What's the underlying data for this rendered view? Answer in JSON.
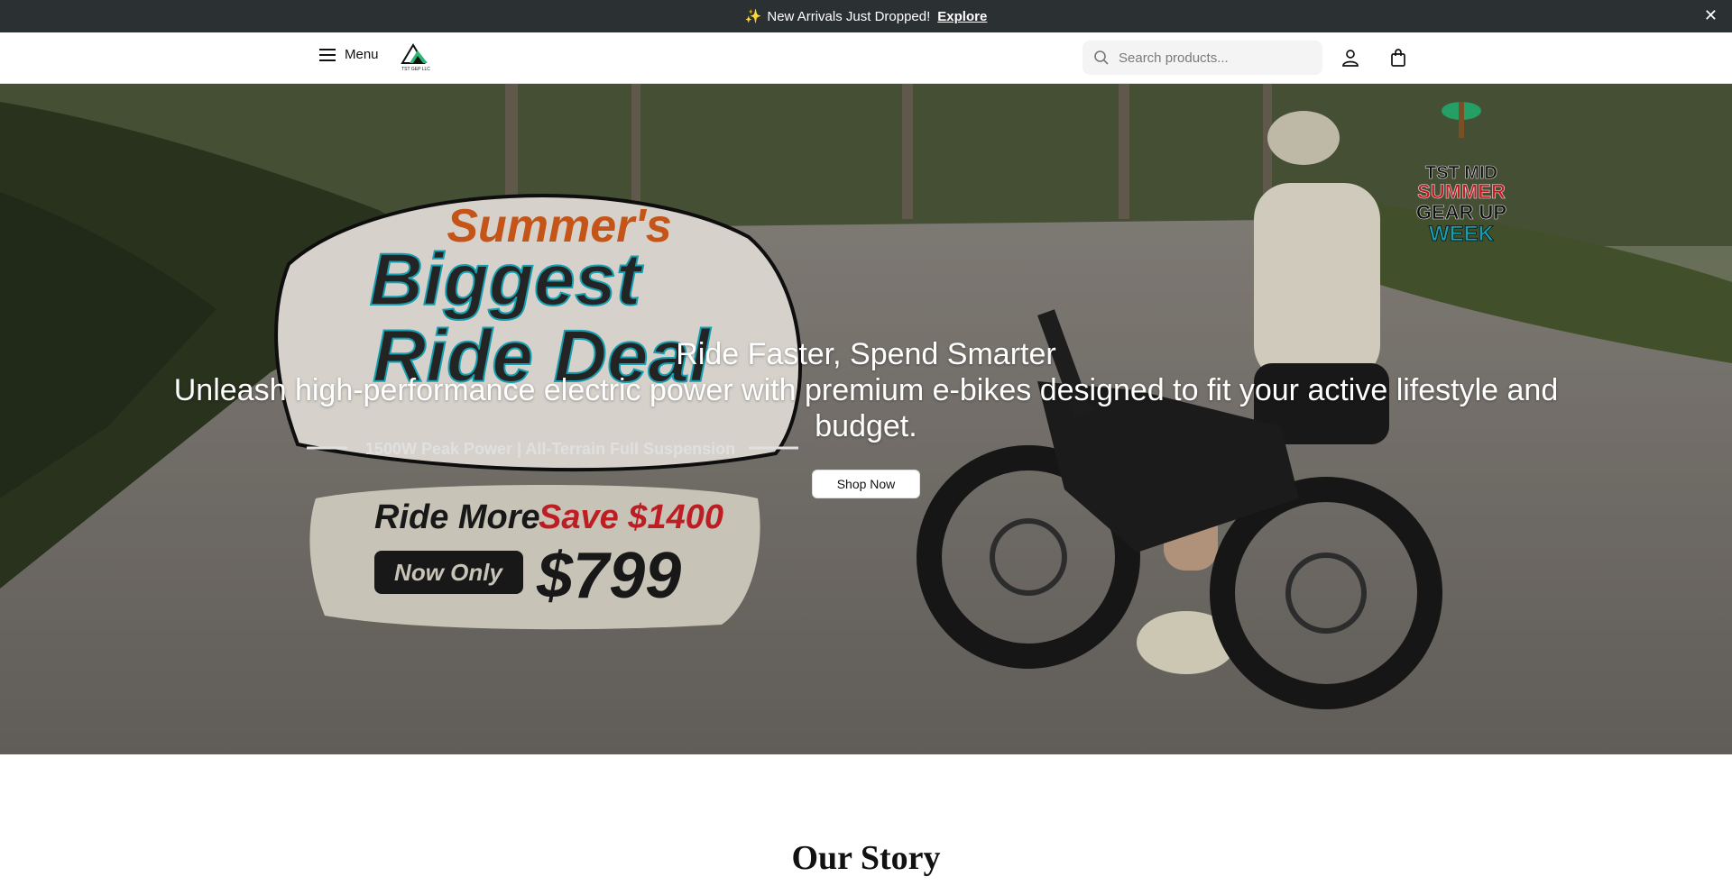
{
  "announcement": {
    "text": "New Arrivals Just Dropped!",
    "link": "Explore",
    "sparkle_icon": "sparkle-icon",
    "close_icon": "close-icon"
  },
  "header": {
    "menu_label": "Menu",
    "logo_text": "TST GEP LLC",
    "search_placeholder": "Search products...",
    "account_icon": "user-icon",
    "cart_icon": "shopping-bag-icon"
  },
  "hero": {
    "title": "Ride Faster, Spend Smarter",
    "subtitle": "Unleash high-performance electric power with premium e-bikes designed to fit your active lifestyle and budget.",
    "cta": "Shop Now",
    "promo": {
      "line1": "Summer's",
      "line2": "Biggest",
      "line3": "Ride Deal",
      "tagline": "1500W Peak Power | All-Terrain Full Suspension",
      "ride_more": "Ride More",
      "save": "Save $1400",
      "now_only": "Now Only",
      "price": "$799"
    },
    "badge": {
      "line1": "TST MID",
      "line2": "SUMMER",
      "line3": "GEAR UP",
      "line4": "WEEK"
    }
  },
  "story": {
    "title": "Our Story"
  },
  "colors": {
    "announcement_bg": "#2b3033",
    "accent_orange": "#e0601b",
    "accent_red": "#d8232a",
    "accent_teal": "#19b6c9"
  }
}
